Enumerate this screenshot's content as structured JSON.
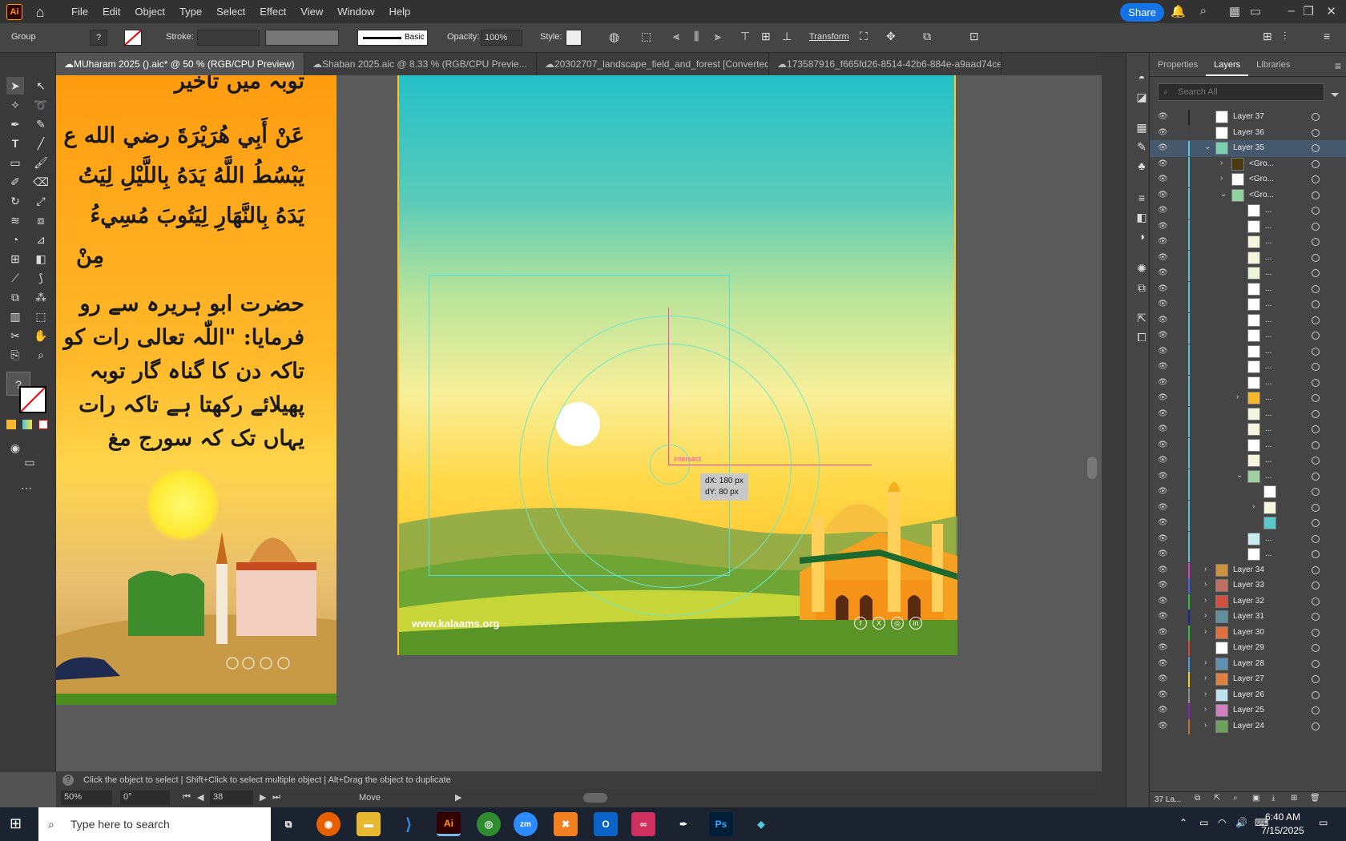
{
  "app": {
    "logo": "Ai",
    "menu": [
      "File",
      "Edit",
      "Object",
      "Type",
      "Select",
      "Effect",
      "View",
      "Window",
      "Help"
    ],
    "share_label": "Share"
  },
  "control": {
    "selection": "Group",
    "stroke_label": "Stroke:",
    "basic_label": "Basic",
    "opacity_label": "Opacity:",
    "opacity_value": "100%",
    "style_label": "Style:",
    "transform_label": "Transform"
  },
  "tabs": [
    {
      "label": "MUharam 2025 ().aic* @ 50 % (RGB/CPU Preview)",
      "close": "×"
    },
    {
      "label": "Shaban 2025.aic @ 8.33 % (RGB/CPU Previe...",
      "close": "×"
    },
    {
      "label": "20302707_landscape_field_and_forest [Converted].eps* ...",
      "close": "×"
    },
    {
      "label": "173587916_f665fd26-8514-42b6-884e-a9aad74cea41 [Converte",
      "close": "×"
    }
  ],
  "artboard_left": {
    "lines": [
      "توبہ میں تاخیر",
      "عَنْ أَبِي هُرَيْرَةَ رضي الله ع",
      "يَبْسُطُ اللَّهُ يَدَهُ بِاللَّيْلِ لِيَتُ",
      "يَدَهُ بِالنَّهَارِ لِيَتُوبَ مُسِيءُ",
      "مِنْ",
      "حضرت ابو ہریرہ سے رو",
      "فرمایا: \"اللّٰہ تعالی رات کو",
      "تاکہ دن کا گناہ گار توبہ",
      "پھیلائے رکھتا ہے تاکہ رات",
      "یہاں تک کہ سورج مغ"
    ]
  },
  "artboard_main": {
    "website": "www.kalaams.org",
    "smart_guide": "intersect",
    "dx": "dX: 180 px",
    "dy": "dY: 80 px"
  },
  "status": {
    "hint": "Click the object to select  |  Shift+Click to select multiple object  |  Alt+Drag the object to duplicate",
    "zoom": "50%",
    "rotate": "0°",
    "artboard": "38",
    "tool": "Move"
  },
  "panel": {
    "tabs": [
      "Properties",
      "Layers",
      "Libraries"
    ],
    "search_placeholder": "Search All",
    "layers": [
      {
        "name": "Layer 37",
        "color": "#222222",
        "thumb": "#ffffff",
        "indent": 0,
        "tw": ""
      },
      {
        "name": "Layer 36",
        "color": "#444444",
        "thumb": "#ffffff",
        "indent": 0,
        "tw": ""
      },
      {
        "name": "Layer 35",
        "color": "#4fc9d6",
        "thumb": "#7ccfb0",
        "indent": 0,
        "tw": "⌄",
        "sel": true
      },
      {
        "name": "<Gro...",
        "color": "#4fc9d6",
        "thumb": "#4a3a10",
        "indent": 1,
        "tw": "›"
      },
      {
        "name": "<Gro...",
        "color": "#4fc9d6",
        "thumb": "#ffffff",
        "indent": 1,
        "tw": "›"
      },
      {
        "name": "<Gro...",
        "color": "#4fc9d6",
        "thumb": "#8fd4a0",
        "indent": 1,
        "tw": "⌄"
      },
      {
        "name": "...",
        "color": "#4fc9d6",
        "thumb": "#ffffff",
        "indent": 2,
        "tw": ""
      },
      {
        "name": "...",
        "color": "#4fc9d6",
        "thumb": "#ffffff",
        "indent": 2,
        "tw": ""
      },
      {
        "name": "...",
        "color": "#4fc9d6",
        "thumb": "#f4f6e0",
        "indent": 2,
        "tw": ""
      },
      {
        "name": "...",
        "color": "#4fc9d6",
        "thumb": "#f4f6e0",
        "indent": 2,
        "tw": ""
      },
      {
        "name": "...",
        "color": "#4fc9d6",
        "thumb": "#eef4d8",
        "indent": 2,
        "tw": ""
      },
      {
        "name": "...",
        "color": "#4fc9d6",
        "thumb": "#ffffff",
        "indent": 2,
        "tw": ""
      },
      {
        "name": "...",
        "color": "#4fc9d6",
        "thumb": "#ffffff",
        "indent": 2,
        "tw": ""
      },
      {
        "name": "...",
        "color": "#4fc9d6",
        "thumb": "#ffffff",
        "indent": 2,
        "tw": ""
      },
      {
        "name": "...",
        "color": "#4fc9d6",
        "thumb": "#ffffff",
        "indent": 2,
        "tw": ""
      },
      {
        "name": "...",
        "color": "#4fc9d6",
        "thumb": "#ffffff",
        "indent": 2,
        "tw": ""
      },
      {
        "name": "...",
        "color": "#4fc9d6",
        "thumb": "#ffffff",
        "indent": 2,
        "tw": ""
      },
      {
        "name": "...",
        "color": "#4fc9d6",
        "thumb": "#ffffff",
        "indent": 2,
        "tw": ""
      },
      {
        "name": "...",
        "color": "#4fc9d6",
        "thumb": "#f5b830",
        "indent": 2,
        "tw": "›"
      },
      {
        "name": "...",
        "color": "#4fc9d6",
        "thumb": "#f4f6e0",
        "indent": 2,
        "tw": ""
      },
      {
        "name": "...",
        "color": "#4fc9d6",
        "thumb": "#f4f6e0",
        "indent": 2,
        "tw": ""
      },
      {
        "name": "...",
        "color": "#4fc9d6",
        "thumb": "#ffffff",
        "indent": 2,
        "tw": ""
      },
      {
        "name": "...",
        "color": "#4fc9d6",
        "thumb": "#f4f6e0",
        "indent": 2,
        "tw": ""
      },
      {
        "name": "...",
        "color": "#4fc9d6",
        "thumb": "#9fd0a0",
        "indent": 2,
        "tw": "⌄"
      },
      {
        "name": "",
        "color": "#4fc9d6",
        "thumb": "#ffffff",
        "indent": 3,
        "tw": ""
      },
      {
        "name": "",
        "color": "#4fc9d6",
        "thumb": "#f4f6e0",
        "indent": 3,
        "tw": "›"
      },
      {
        "name": "",
        "color": "#4fc9d6",
        "thumb": "#5bc9c8",
        "indent": 3,
        "tw": ""
      },
      {
        "name": "...",
        "color": "#4fc9d6",
        "thumb": "#c8ecf0",
        "indent": 2,
        "tw": ""
      },
      {
        "name": "...",
        "color": "#4fc9d6",
        "thumb": "#ffffff",
        "indent": 2,
        "tw": ""
      },
      {
        "name": "Layer 34",
        "color": "#e040c0",
        "thumb": "#d09040",
        "indent": 0,
        "tw": "›"
      },
      {
        "name": "Layer 33",
        "color": "#4060ff",
        "thumb": "#c07060",
        "indent": 0,
        "tw": "›"
      },
      {
        "name": "Layer 32",
        "color": "#30c040",
        "thumb": "#d05040",
        "indent": 0,
        "tw": "›"
      },
      {
        "name": "Layer 31",
        "color": "#2020a0",
        "thumb": "#6090a0",
        "indent": 0,
        "tw": "›"
      },
      {
        "name": "Layer 30",
        "color": "#30c040",
        "thumb": "#e07040",
        "indent": 0,
        "tw": "›"
      },
      {
        "name": "Layer 29",
        "color": "#e04040",
        "thumb": "#ffffff",
        "indent": 0,
        "tw": ""
      },
      {
        "name": "Layer 28",
        "color": "#40a0e0",
        "thumb": "#6090b0",
        "indent": 0,
        "tw": "›"
      },
      {
        "name": "Layer 27",
        "color": "#f0d020",
        "thumb": "#e08040",
        "indent": 0,
        "tw": "›"
      },
      {
        "name": "Layer 26",
        "color": "#909090",
        "thumb": "#c0e0f0",
        "indent": 0,
        "tw": "›"
      },
      {
        "name": "Layer 25",
        "color": "#8020c0",
        "thumb": "#d080c0",
        "indent": 0,
        "tw": "›"
      },
      {
        "name": "Layer 24",
        "color": "#c07030",
        "thumb": "#70a060",
        "indent": 0,
        "tw": "›"
      }
    ],
    "footer": "37 La..."
  },
  "taskbar": {
    "search": "Type here to search",
    "time": "6:40 AM",
    "date": "7/15/2025"
  }
}
